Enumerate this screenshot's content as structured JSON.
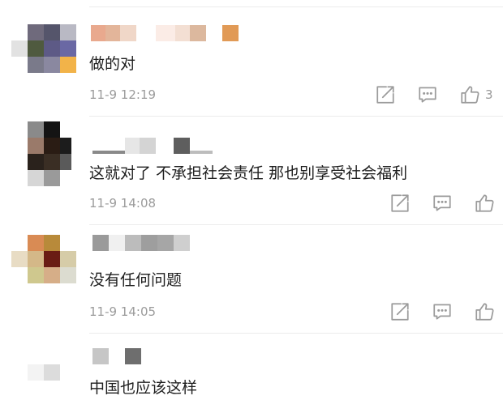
{
  "comments": [
    {
      "text": "做的对",
      "time": "11-9 12:19",
      "likes": "3"
    },
    {
      "text": "这就对了 不承担社会责任 那也别享受社会福利",
      "time": "11-9 14:08",
      "likes": ""
    },
    {
      "text": "没有任何问题",
      "time": "11-9 14:05",
      "likes": ""
    },
    {
      "text": "中国也应该这样",
      "time": "",
      "likes": ""
    }
  ],
  "icons": {
    "share": "share-icon",
    "comment": "comment-icon",
    "like": "thumbs-up-icon"
  },
  "colors": {
    "text": "#1e1e1e",
    "meta": "#9b9b9b",
    "divider": "#ececec",
    "icon": "#9b9b9b"
  }
}
